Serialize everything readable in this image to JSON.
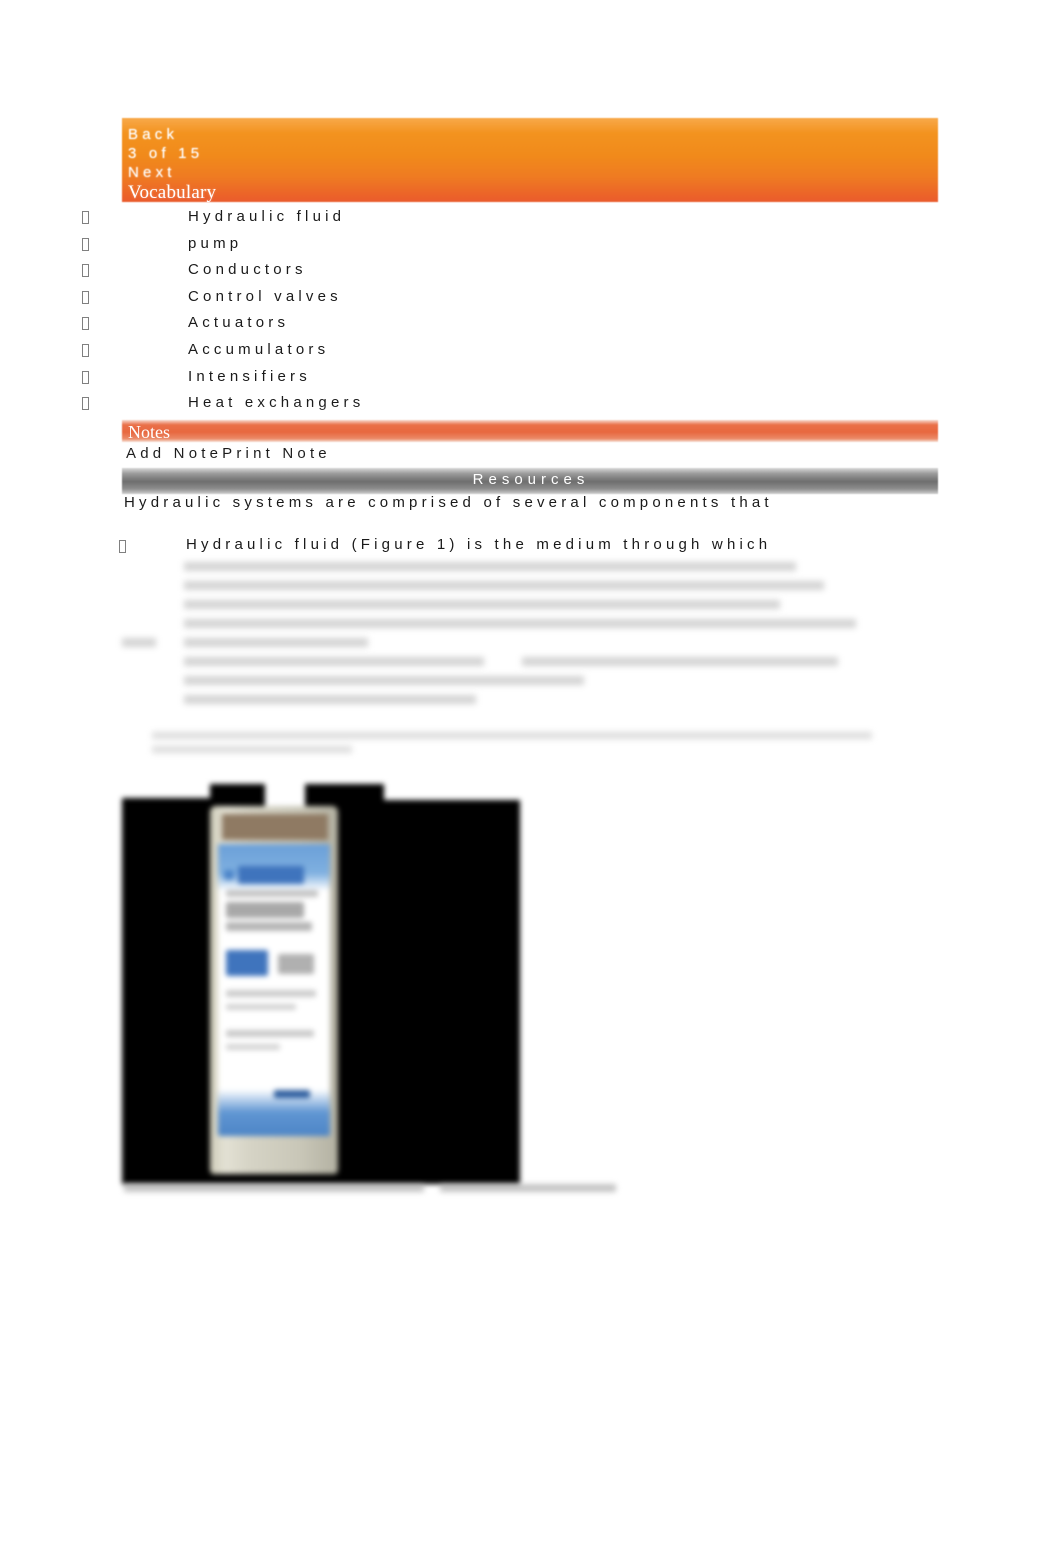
{
  "nav": {
    "back_label": "Back",
    "page_indicator": "3 of 15",
    "next_label": "Next"
  },
  "vocabulary": {
    "heading": "Vocabulary",
    "items": [
      {
        "label": "Hydraulic fluid"
      },
      {
        "label": "pump"
      },
      {
        "label": "Conductors"
      },
      {
        "label": "Control valves"
      },
      {
        "label": "Actuators"
      },
      {
        "label": "Accumulators"
      },
      {
        "label": "Intensifiers"
      },
      {
        "label": "Heat exchangers"
      }
    ]
  },
  "notes": {
    "heading": "Notes",
    "add_note_label": "Add Note",
    "print_note_label": "Print Note"
  },
  "resources": {
    "heading": "Resources"
  },
  "content": {
    "intro_line": "Hydraulic systems are comprised of several components that",
    "fluid_bullet": "Hydraulic fluid (Figure 1) is the medium through which"
  },
  "colors": {
    "nav_bar_orange": "#F18A1B",
    "nav_bar_orange_bottom": "#EA5B2D",
    "notes_bar_coral": "#E8683F",
    "resources_bar_gray": "#6E6E6E",
    "body_text": "#1A1A1A",
    "heading_text": "#FFFFFF"
  }
}
